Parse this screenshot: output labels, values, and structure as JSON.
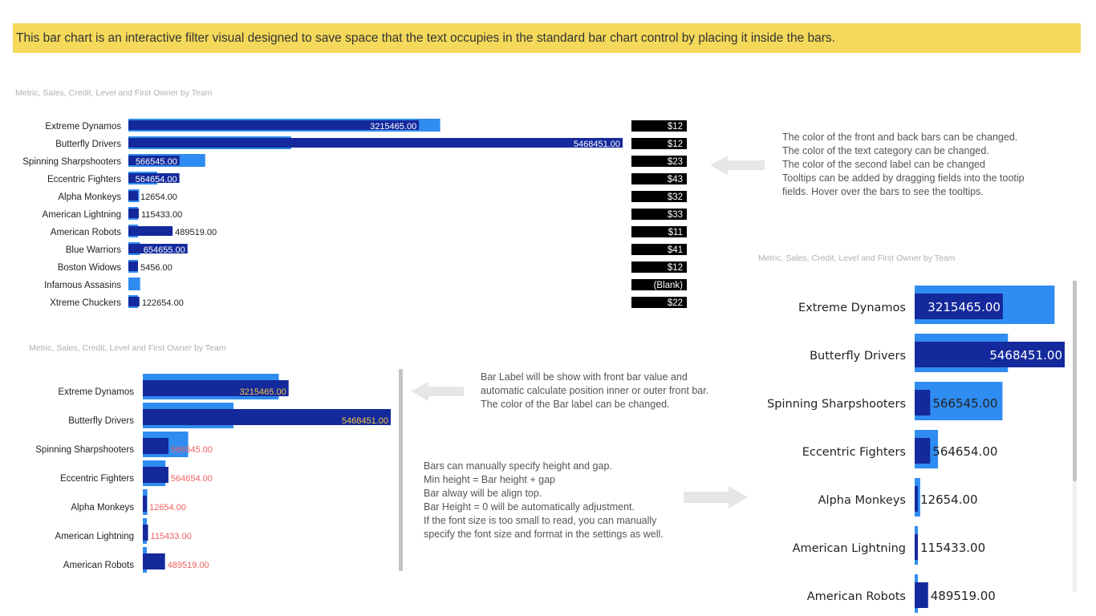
{
  "banner": {
    "text": "This bar chart is an interactive filter visual designed to save space that the text occupies in the standard bar chart control by placing it inside the bars."
  },
  "colors": {
    "back_bar": "#2f8cf0",
    "front_bar": "#14299c",
    "label_box": "#000000",
    "accent_label": "#f5c542",
    "red_label": "#f06060",
    "banner": "#f4d95a"
  },
  "notes": {
    "top_right": [
      "The color of the front and back bars can be changed.",
      "The color of the text category can be changed.",
      "The color of the second label can be changed",
      "Tooltips can be added by dragging fields into the tootip",
      "fields. Hover over the bars to see the tooltips."
    ],
    "middle": [
      "Bar Label will be show with front bar value and",
      "automatic calculate position inner or outer front bar.",
      "The color of the Bar label can be changed."
    ],
    "bottom": [
      "Bars can manually specify height and gap.",
      "Min height = Bar height + gap",
      "Bar alway will be align top.",
      "Bar Height = 0 will be automatically adjustment.",
      "If the font size is too small to read, you can manually",
      "specify the font size and format in the settings as well."
    ]
  },
  "chart_data": [
    {
      "type": "bar",
      "title": "Metric, Sales, Credit, Level and First Owner by Team",
      "categories": [
        "Extreme Dynamos",
        "Butterfly Drivers",
        "Spinning Sharpshooters",
        "Eccentric Fighters",
        "Alpha Monkeys",
        "American Lightning",
        "American Robots",
        "Blue Warriors",
        "Boston Widows",
        "Infamous Assasins",
        "Xtreme Chuckers"
      ],
      "series": [
        {
          "values": [
            3215465,
            5468451,
            566545,
            564654,
            12654,
            115433,
            489519,
            654655,
            5456,
            null,
            122654
          ]
        },
        {
          "values": [
            3450000,
            1800000,
            850000,
            320000,
            120000,
            60000,
            50000,
            130000,
            100000,
            130000,
            60000
          ]
        }
      ],
      "bar_labels": [
        "3215465.00",
        "5468451.00",
        "566545.00",
        "564654.00",
        "12654.00",
        "115433.00",
        "489519.00",
        "654655.00",
        "5456.00",
        "",
        "122654.00"
      ],
      "second_labels": [
        "$12",
        "$12",
        "$23",
        "$43",
        "$32",
        "$33",
        "$11",
        "$41",
        "$12",
        "(Blank)",
        "$22"
      ],
      "xlim": [
        0,
        5468451
      ]
    },
    {
      "type": "bar",
      "title": "Metric, Sales, Credit, Level and First Owner by Team",
      "categories": [
        "Extreme Dynamos",
        "Butterfly Drivers",
        "Spinning Sharpshooters",
        "Eccentric Fighters",
        "Alpha Monkeys",
        "American Lightning",
        "American Robots"
      ],
      "series": [
        {
          "values": [
            3215465,
            5468451,
            566545,
            564654,
            12654,
            115433,
            489519
          ]
        },
        {
          "values": [
            3000000,
            2000000,
            1000000,
            500000,
            100000,
            60000,
            40000
          ]
        }
      ],
      "bar_labels": [
        "3215465.00",
        "5468451.00",
        "566545.00",
        "564654.00",
        "12654.00",
        "115433.00",
        "489519.00"
      ],
      "xlim": [
        0,
        5468451
      ]
    },
    {
      "type": "bar",
      "title": "Metric, Sales, Credit, Level and First Owner by Team",
      "categories": [
        "Extreme Dynamos",
        "Butterfly Drivers",
        "Spinning Sharpshooters",
        "Eccentric Fighters",
        "Alpha Monkeys",
        "American Lightning",
        "American Robots"
      ],
      "series": [
        {
          "values": [
            3215465,
            5468451,
            566545,
            564654,
            12654,
            115433,
            489519
          ]
        },
        {
          "values": [
            5100000,
            3400000,
            3200000,
            850000,
            200000,
            100000,
            100000
          ]
        }
      ],
      "bar_labels": [
        "3215465.00",
        "5468451.00",
        "566545.00",
        "564654.00",
        "12654.00",
        "115433.00",
        "489519.00"
      ],
      "xlim": [
        0,
        5468451
      ]
    }
  ]
}
